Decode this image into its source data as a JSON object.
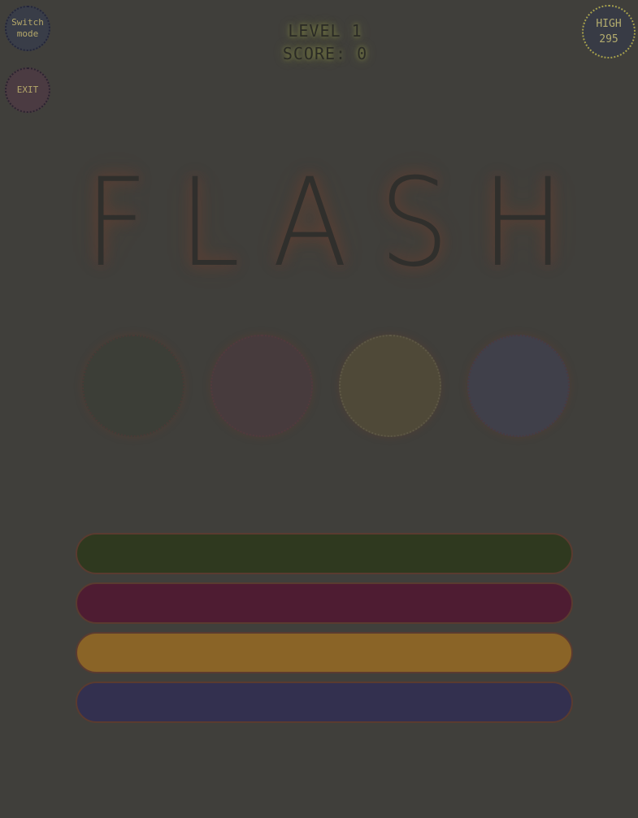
{
  "controls": {
    "switch_mode_label": "Switch mode",
    "exit_label": "EXIT"
  },
  "high_score": {
    "label": "HIGH",
    "value": "295"
  },
  "hud": {
    "level": "LEVEL 1",
    "score": "SCORE: 0"
  },
  "title_letters": [
    "F",
    "L",
    "A",
    "S",
    "H"
  ],
  "circles": [
    {
      "color": "green"
    },
    {
      "color": "maroon"
    },
    {
      "color": "yellow"
    },
    {
      "color": "blue"
    }
  ],
  "bars": [
    {
      "color": "green",
      "hex": "#2f391f"
    },
    {
      "color": "maroon",
      "hex": "#4e1c32"
    },
    {
      "color": "orange",
      "hex": "#8a6427"
    },
    {
      "color": "navy",
      "hex": "#33304f"
    }
  ]
}
